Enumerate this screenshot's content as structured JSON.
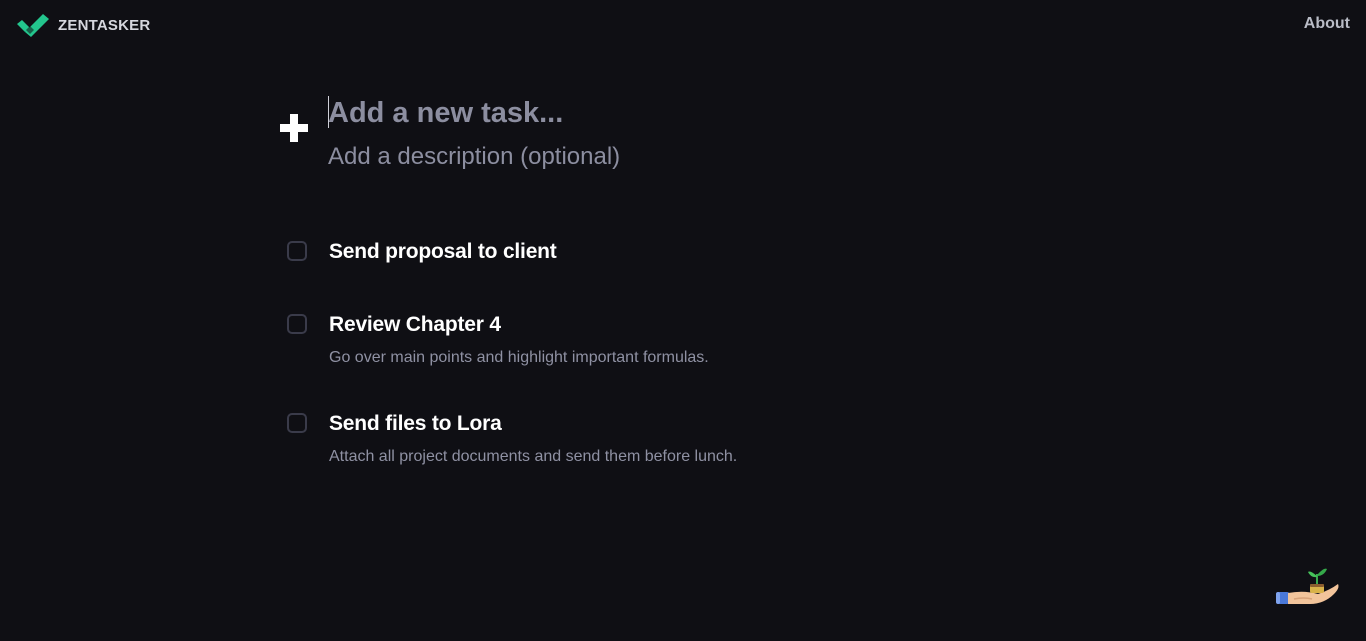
{
  "header": {
    "brand_name": "ZENTASKER",
    "brand_logo": "checkmark-logo-icon",
    "about_label": "About",
    "accent_color": "#23c58d"
  },
  "composer": {
    "plus_icon": "plus-icon",
    "task_placeholder": "Add a new task...",
    "task_value": "",
    "description_placeholder": "Add a description (optional)",
    "description_value": ""
  },
  "tasks": [
    {
      "title": "Send proposal to client",
      "description": "",
      "checked": false
    },
    {
      "title": "Review Chapter 4",
      "description": "Go over main points and highlight important formulas.",
      "checked": false
    },
    {
      "title": "Send files to Lora",
      "description": "Attach all project documents and send them before lunch.",
      "checked": false
    }
  ],
  "illustration": {
    "icon": "hand-holding-plant-icon"
  },
  "colors": {
    "background": "#0f0f14",
    "placeholder": "#8c8ea0",
    "task_title": "#ffffff",
    "task_description": "#8f91a3",
    "checkbox_border": "#3a3b4a"
  }
}
